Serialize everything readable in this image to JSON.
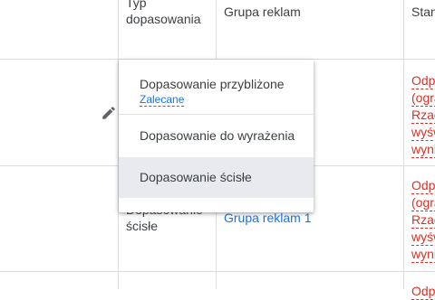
{
  "headers": {
    "match_type_line1": "Typ",
    "match_type_line2": "dopasowania",
    "ad_group": "Grupa reklam",
    "status": "Stan"
  },
  "rows": [
    {
      "status_lines": [
        "Odpo",
        "(ogra",
        "Rzad",
        "wyśw",
        "wyni"
      ]
    },
    {
      "match_type_lines": [
        "Dopasowanie",
        "ścisłe"
      ],
      "ad_group": "Grupa reklam 1",
      "status_lines": [
        "Odpo",
        "(ogra",
        "Rzad",
        "wyśw",
        "wyni"
      ]
    },
    {
      "status_lines": [
        "Odpo"
      ]
    }
  ],
  "menu": {
    "items": [
      {
        "label": "Dopasowanie przybliżone",
        "sublabel": "Zalecane"
      },
      {
        "label": "Dopasowanie do wyrażenia"
      },
      {
        "label": "Dopasowanie ścisłe",
        "selected": true
      }
    ]
  },
  "icons": {
    "edit": "pencil-icon"
  },
  "colors": {
    "link": "#1a73e8",
    "status_red": "#d93025",
    "selected_bg": "#e8eaed"
  }
}
